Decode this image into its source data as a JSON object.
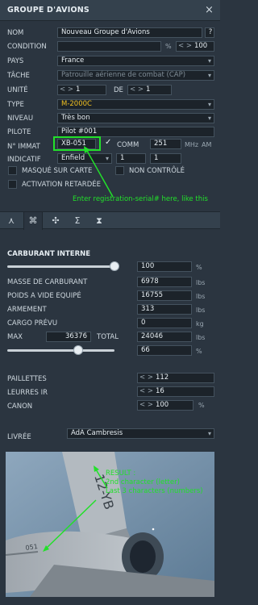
{
  "window": {
    "title": "GROUPE D'AVIONS",
    "help": "?"
  },
  "form": {
    "nom": {
      "label": "NOM",
      "value": "Nouveau Groupe d'Avions"
    },
    "condition": {
      "label": "CONDITION",
      "value": "",
      "unit": "%",
      "spin": "100"
    },
    "pays": {
      "label": "PAYS",
      "value": "France"
    },
    "tache": {
      "label": "TÂCHE",
      "value": "Patrouille aérienne de combat (CAP)"
    },
    "unite": {
      "label": "UNITÉ",
      "value": "1",
      "de_label": "DE",
      "de_value": "1"
    },
    "type": {
      "label": "TYPE",
      "value": "M-2000C"
    },
    "niveau": {
      "label": "NIVEAU",
      "value": "Très bon"
    },
    "pilote": {
      "label": "PILOTE",
      "value": "Pilot #001"
    },
    "immat": {
      "label": "N° IMMAT",
      "value": "XB-051",
      "comm_label": "COMM",
      "comm_value": "251",
      "mhz": "MHz",
      "am": "AM"
    },
    "indicatif": {
      "label": "INDICATIF",
      "value": "Enfield",
      "n1": "1",
      "n2": "1"
    },
    "masque": {
      "label": "MASQUÉ SUR CARTE"
    },
    "non_controle": {
      "label": "NON CONTRÔLÉ"
    },
    "activation": {
      "label": "ACTIVATION RETARDÉE"
    },
    "annotation": "Enter registration-serial# here, like this"
  },
  "tabs": [
    "route-icon",
    "payload-icon",
    "fan-icon",
    "sigma-icon",
    "hourglass-icon"
  ],
  "fuel": {
    "section": "CARBURANT INTERNE",
    "percent_value": "100",
    "percent_unit": "%",
    "slider_fraction": 1.0,
    "masse_label": "MASSE DE CARBURANT",
    "masse_value": "6978",
    "masse_unit": "lbs",
    "poids_label": "POIDS A VIDE EQUIPÉ",
    "poids_value": "16755",
    "poids_unit": "lbs",
    "armement_label": "ARMEMENT",
    "armement_value": "313",
    "armement_unit": "lbs",
    "cargo_label": "CARGO PRÉVU",
    "cargo_value": "0",
    "cargo_unit": "kg",
    "max_label": "MAX",
    "max_value": "36376",
    "total_label": "TOTAL",
    "total_value": "24046",
    "total_unit": "lbs",
    "ratio_value": "66",
    "ratio_unit": "%",
    "ratio_fraction": 0.66
  },
  "counters": {
    "paillettes_label": "PAILLETTES",
    "paillettes_value": "112",
    "leurres_label": "LEURRES IR",
    "leurres_value": "16",
    "canon_label": "CANON",
    "canon_value": "100",
    "canon_unit": "%"
  },
  "livree": {
    "label": "LIVRÉE",
    "value": "AdA Cambresis",
    "result_title": "RESULT :",
    "result_line1": "2nd character (letter)",
    "result_line2": "Last 3 characters (numbers)",
    "tail_text": "12-YB",
    "nose_text": "051"
  },
  "colors": {
    "annotation": "#22e02a",
    "accent": "#f0c020",
    "panel": "#2b3540"
  }
}
